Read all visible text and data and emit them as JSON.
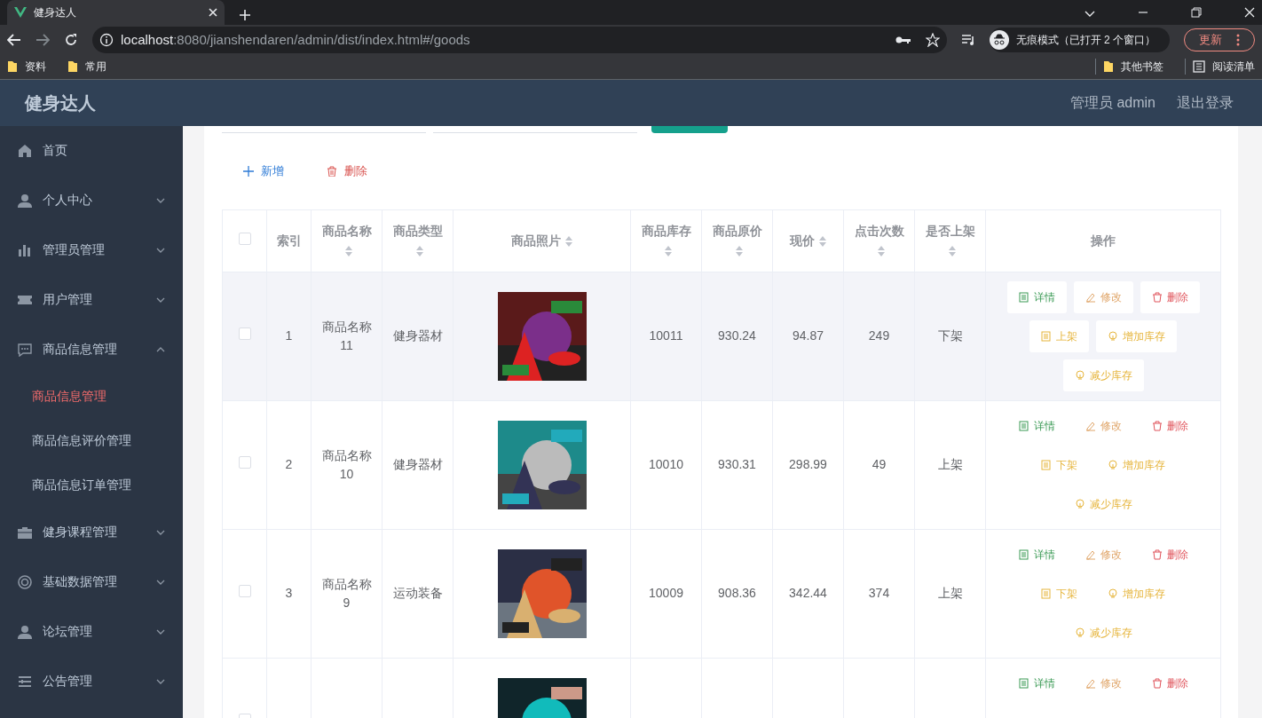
{
  "browser": {
    "tab_title": "健身达人",
    "url_host": "localhost",
    "url_rest": ":8080/jianshendaren/admin/dist/index.html#/goods",
    "profile": "无痕模式（已打开 2 个窗口）",
    "update_button": "更新",
    "bookmarks": [
      "资料",
      "常用"
    ],
    "bookmarks_right": [
      "其他书签",
      "阅读清单"
    ]
  },
  "app": {
    "title": "健身达人",
    "user": "管理员 admin",
    "logout": "退出登录"
  },
  "sidebar": {
    "items": [
      {
        "label": "首页"
      },
      {
        "label": "个人中心",
        "expanded": false
      },
      {
        "label": "管理员管理",
        "expanded": false
      },
      {
        "label": "用户管理",
        "expanded": false
      },
      {
        "label": "商品信息管理",
        "expanded": true,
        "children": [
          {
            "label": "商品信息管理",
            "selected": true
          },
          {
            "label": "商品信息评价管理",
            "selected": false
          },
          {
            "label": "商品信息订单管理",
            "selected": false
          }
        ]
      },
      {
        "label": "健身课程管理",
        "expanded": false
      },
      {
        "label": "基础数据管理",
        "expanded": false
      },
      {
        "label": "论坛管理",
        "expanded": false
      },
      {
        "label": "公告管理",
        "expanded": false
      }
    ]
  },
  "search_bar": [
    {
      "kind": "input"
    },
    {
      "kind": "input"
    },
    {
      "kind": "button"
    }
  ],
  "toolbar": [
    {
      "kind": "add",
      "label": "新增"
    },
    {
      "kind": "delete",
      "label": "删除"
    }
  ],
  "table": {
    "header_checked": false,
    "columns": [
      {
        "label": "索引",
        "sortable": false
      },
      {
        "label": "商品名称",
        "sortable": true
      },
      {
        "label": "商品类型",
        "sortable": true
      },
      {
        "label": "商品照片",
        "sortable": true
      },
      {
        "label": "商品库存",
        "sortable": true
      },
      {
        "label": "商品原价",
        "sortable": true
      },
      {
        "label": "现价",
        "sortable": true
      },
      {
        "label": "点击次数",
        "sortable": true
      },
      {
        "label": "是否上架",
        "sortable": true
      },
      {
        "label": "操作",
        "sortable": false
      }
    ],
    "rows": [
      {
        "highlighted": true,
        "checked": false,
        "cells": [
          "1",
          "商品名称11",
          "健身器材",
          null,
          "10011",
          "930.24",
          "94.87",
          "249",
          "下架"
        ],
        "photo": {
          "kind": "picture"
        },
        "actions": [
          {
            "kind": "detail",
            "label": "详情"
          },
          {
            "kind": "edit",
            "label": "修改"
          },
          {
            "kind": "delete",
            "label": "删除"
          },
          {
            "kind": "toggle",
            "label": "上架"
          },
          {
            "kind": "stock",
            "label": "增加库存"
          },
          {
            "kind": "stock",
            "label": "减少库存"
          }
        ]
      },
      {
        "highlighted": false,
        "checked": false,
        "cells": [
          "2",
          "商品名称10",
          "健身器材",
          null,
          "10010",
          "930.31",
          "298.99",
          "49",
          "上架"
        ],
        "photo": {
          "kind": "picture"
        },
        "actions": [
          {
            "kind": "detail",
            "label": "详情"
          },
          {
            "kind": "edit",
            "label": "修改"
          },
          {
            "kind": "delete",
            "label": "删除"
          },
          {
            "kind": "toggle",
            "label": "下架"
          },
          {
            "kind": "stock",
            "label": "增加库存"
          },
          {
            "kind": "stock",
            "label": "减少库存"
          }
        ]
      },
      {
        "highlighted": false,
        "checked": false,
        "cells": [
          "3",
          "商品名称9",
          "运动装备",
          null,
          "10009",
          "908.36",
          "342.44",
          "374",
          "上架"
        ],
        "photo": {
          "kind": "picture"
        },
        "actions": [
          {
            "kind": "detail",
            "label": "详情"
          },
          {
            "kind": "edit",
            "label": "修改"
          },
          {
            "kind": "delete",
            "label": "删除"
          },
          {
            "kind": "toggle",
            "label": "下架"
          },
          {
            "kind": "stock",
            "label": "增加库存"
          },
          {
            "kind": "stock",
            "label": "减少库存"
          }
        ]
      },
      {
        "highlighted": false,
        "checked": false,
        "cells": [
          null,
          null,
          null,
          null,
          null,
          null,
          null,
          null,
          null
        ],
        "photo": {
          "kind": "picture"
        },
        "actions": [
          {
            "kind": "detail",
            "label": "详情"
          },
          {
            "kind": "edit",
            "label": "修改"
          },
          {
            "kind": "delete",
            "label": "删除"
          }
        ]
      }
    ]
  }
}
